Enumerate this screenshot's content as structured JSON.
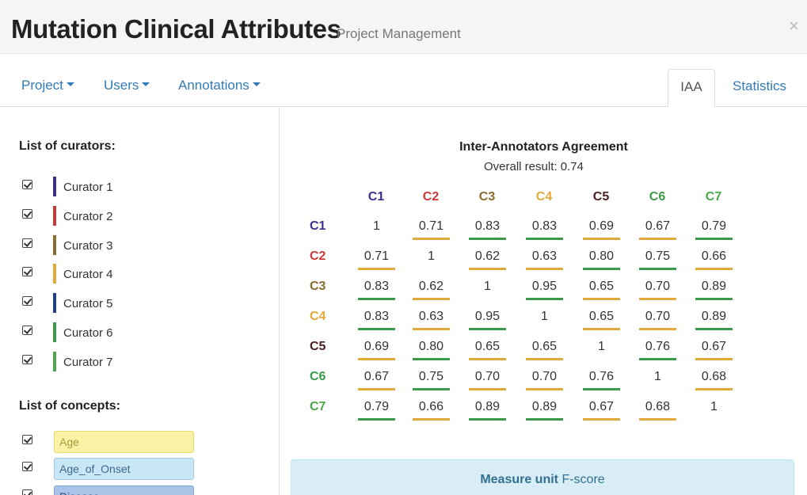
{
  "header": {
    "title": "Mutation Clinical Attributes",
    "subtitle": "Project Management",
    "close": "×"
  },
  "nav": {
    "menus": [
      {
        "label": "Project"
      },
      {
        "label": "Users"
      },
      {
        "label": "Annotations"
      }
    ],
    "tabs": [
      {
        "label": "IAA",
        "active": true
      },
      {
        "label": "Statistics",
        "active": false
      }
    ]
  },
  "curators": {
    "heading": "List of curators:",
    "items": [
      {
        "label": "Curator 1",
        "color": "#3a2e8f"
      },
      {
        "label": "Curator 2",
        "color": "#c83a3a"
      },
      {
        "label": "Curator 3",
        "color": "#8a6d2e"
      },
      {
        "label": "Curator 4",
        "color": "#e2a83a"
      },
      {
        "label": "Curator 5",
        "color": "#1f3f8a"
      },
      {
        "label": "Curator 6",
        "color": "#3a9a4a"
      },
      {
        "label": "Curator 7",
        "color": "#4aa84a"
      }
    ]
  },
  "concepts": {
    "heading": "List of concepts:",
    "items": [
      {
        "label": "Age",
        "bg": "#faf3a6",
        "border": "#e8d96a",
        "color": "#a89a3a"
      },
      {
        "label": "Age_of_Onset",
        "bg": "#c9e6f7",
        "border": "#9ccbe8",
        "color": "#3a6a8a"
      },
      {
        "label": "Disease",
        "bg": "#a9c4e6",
        "border": "#7ea6d6",
        "color": "#2a4a7a"
      }
    ]
  },
  "iaa": {
    "title": "Inter-Annotators Agreement",
    "overall": "Overall result: 0.74",
    "labels": [
      "C1",
      "C2",
      "C3",
      "C4",
      "C5",
      "C6",
      "C7"
    ],
    "label_colors": [
      "#3a2e8f",
      "#c83a3a",
      "#8a6d2e",
      "#e2a83a",
      "#4a1f1f",
      "#3a9a4a",
      "#4aa84a"
    ],
    "matrix": [
      [
        "1",
        "0.71",
        "0.83",
        "0.83",
        "0.69",
        "0.67",
        "0.79"
      ],
      [
        "0.71",
        "1",
        "0.62",
        "0.63",
        "0.80",
        "0.75",
        "0.66"
      ],
      [
        "0.83",
        "0.62",
        "1",
        "0.95",
        "0.65",
        "0.70",
        "0.89"
      ],
      [
        "0.83",
        "0.63",
        "0.95",
        "1",
        "0.65",
        "0.70",
        "0.89"
      ],
      [
        "0.69",
        "0.80",
        "0.65",
        "0.65",
        "1",
        "0.76",
        "0.67"
      ],
      [
        "0.67",
        "0.75",
        "0.70",
        "0.70",
        "0.76",
        "1",
        "0.68"
      ],
      [
        "0.79",
        "0.66",
        "0.89",
        "0.89",
        "0.67",
        "0.68",
        "1"
      ]
    ],
    "level_colors": {
      "high": "#3a9a4a",
      "medium": "#e0a93a"
    }
  },
  "measure": {
    "label": "Measure unit",
    "value": "F-score"
  }
}
